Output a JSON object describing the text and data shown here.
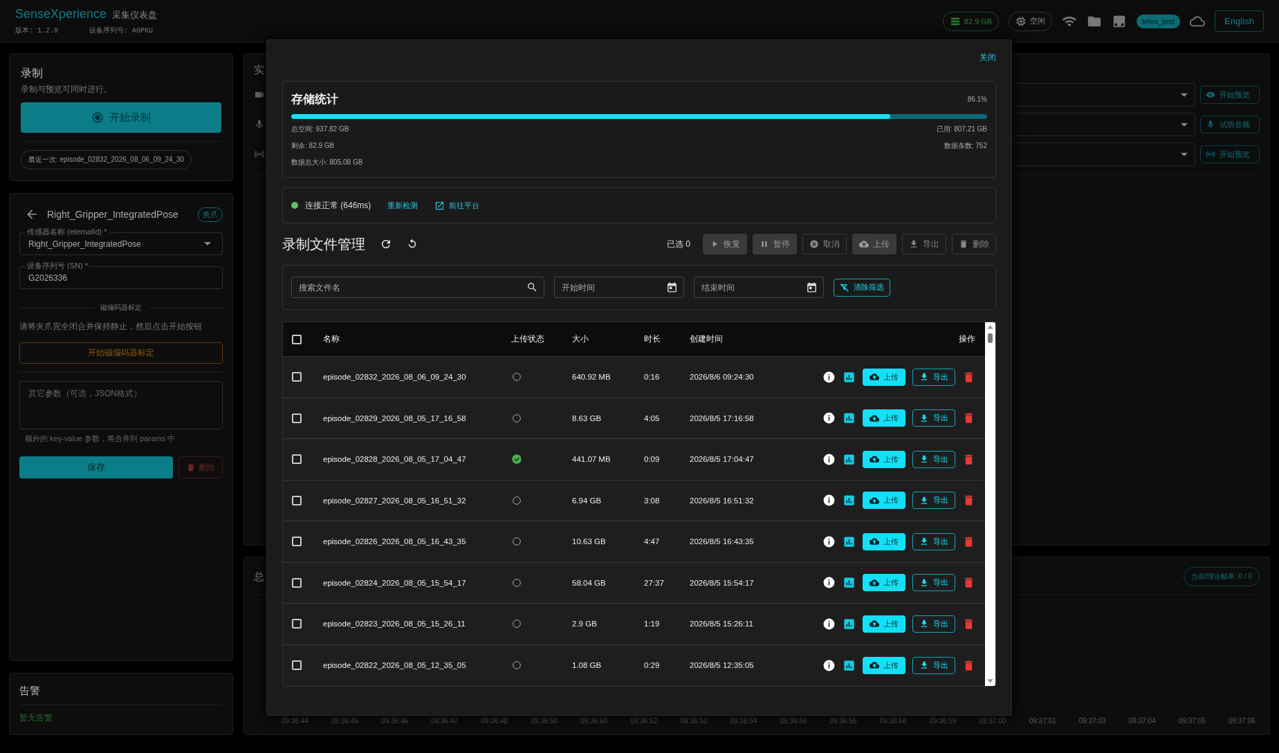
{
  "header": {
    "title": "SenseXperience",
    "subtitle": "采集仪表盘",
    "version": "版本: 1.2.0",
    "serial": "设备序列号: AGPKU",
    "storage": "82.9 GB",
    "status": "空闲",
    "user": "telex_test",
    "language": "English"
  },
  "recording": {
    "title": "录制",
    "hint": "录制与预览可同时进行。",
    "start": "开始录制",
    "last": "最近一次: episode_02832_2026_08_06_09_24_30"
  },
  "sensor": {
    "title": "Right_Gripper_IntegratedPose",
    "tag": "夹爪",
    "name_label": "传感器名称 (eternalId) *",
    "name_value": "Right_Gripper_IntegratedPose",
    "sn_label": "设备序列号 (SN) *",
    "sn_value": "G2026336",
    "section": "磁编码器标定",
    "instruction": "请将夹爪完全闭合并保持静止，然后点击开始按钮",
    "calibrate": "开始磁编码器标定",
    "params_placeholder": "其它参数（可选，JSON格式）",
    "params_help": "额外的 key-value 参数，将合并到 params 中",
    "save": "保存",
    "delete": "删除"
  },
  "alarms": {
    "title": "告警",
    "empty": "暂无告警"
  },
  "preview": {
    "title": "实",
    "buttons": [
      {
        "kind": "camera",
        "label": "开始预览"
      },
      {
        "kind": "mic",
        "label": "试听音频"
      },
      {
        "kind": "radio",
        "label": "开始预览"
      }
    ]
  },
  "stats_panel": {
    "title": "总",
    "badge": "当前/理论帧率: 0 / 0",
    "time_labels": [
      "09:36:44",
      "09:36:45",
      "09:36:46",
      "09:36:47",
      "09:36:48",
      "09:36:50",
      "09:36:50",
      "09:36:52",
      "09:36:53",
      "09:36:54",
      "09:36:56",
      "09:36:56",
      "09:36:58",
      "09:36:59",
      "09:37:00",
      "09:37:01",
      "09:37:03",
      "09:37:04",
      "09:37:05",
      "09:37:06"
    ]
  },
  "dialog": {
    "close": "关闭",
    "storage": {
      "title": "存储统计",
      "percent": "86.1%",
      "level": 0.861,
      "total": "总空间: 937.82 GB",
      "used": "已用: 807.21 GB",
      "free": "剩余: 82.9 GB",
      "count": "数据条数: 752",
      "data_size": "数据总大小: 805.08 GB"
    },
    "connection": {
      "ok": true,
      "text": "连接正常 (646ms)",
      "recheck": "重新检测",
      "platform": "前往平台"
    },
    "files": {
      "title": "录制文件管理",
      "selected": "已选 0",
      "all_checked": false,
      "actions": [
        {
          "kind": "resume",
          "label": "恢复",
          "disabled": true
        },
        {
          "kind": "pause",
          "label": "暂停",
          "disabled": true
        },
        {
          "kind": "cancel",
          "label": "取消",
          "disabled": true
        },
        {
          "kind": "upload",
          "label": "上传",
          "disabled": true
        },
        {
          "kind": "export",
          "label": "导出",
          "disabled": true
        },
        {
          "kind": "delete",
          "label": "删除",
          "disabled": true
        }
      ],
      "search_placeholder": "搜索文件名",
      "start_placeholder": "开始时间",
      "end_placeholder": "结束时间",
      "clear": "清除筛选",
      "columns": [
        "名称",
        "上传状态",
        "大小",
        "时长",
        "创建时间",
        "操作"
      ],
      "rows": [
        {
          "checked": false,
          "name": "episode_02832_2026_08_06_09_24_30",
          "uploaded": false,
          "size": "640.92 MB",
          "duration": "0:16",
          "created": "2026/8/6 09:24:30",
          "upload": "上传",
          "export": "导出"
        },
        {
          "checked": false,
          "name": "episode_02829_2026_08_05_17_16_58",
          "uploaded": false,
          "size": "8.63 GB",
          "duration": "4:05",
          "created": "2026/8/5 17:16:58",
          "upload": "上传",
          "export": "导出"
        },
        {
          "checked": false,
          "name": "episode_02828_2026_08_05_17_04_47",
          "uploaded": true,
          "size": "441.07 MB",
          "duration": "0:09",
          "created": "2026/8/5 17:04:47",
          "upload": "上传",
          "export": "导出"
        },
        {
          "checked": false,
          "name": "episode_02827_2026_08_05_16_51_32",
          "uploaded": false,
          "size": "6.94 GB",
          "duration": "3:08",
          "created": "2026/8/5 16:51:32",
          "upload": "上传",
          "export": "导出"
        },
        {
          "checked": false,
          "name": "episode_02826_2026_08_05_16_43_35",
          "uploaded": false,
          "size": "10.63 GB",
          "duration": "4:47",
          "created": "2026/8/5 16:43:35",
          "upload": "上传",
          "export": "导出"
        },
        {
          "checked": false,
          "name": "episode_02824_2026_08_05_15_54_17",
          "uploaded": false,
          "size": "58.04 GB",
          "duration": "27:37",
          "created": "2026/8/5 15:54:17",
          "upload": "上传",
          "export": "导出"
        },
        {
          "checked": false,
          "name": "episode_02823_2026_08_05_15_26_11",
          "uploaded": false,
          "size": "2.9 GB",
          "duration": "1:19",
          "created": "2026/8/5 15:26:11",
          "upload": "上传",
          "export": "导出"
        },
        {
          "checked": false,
          "name": "episode_02822_2026_08_05_12_35_05",
          "uploaded": false,
          "size": "1.08 GB",
          "duration": "0:29",
          "created": "2026/8/5 12:35:05",
          "upload": "上传",
          "export": "导出"
        }
      ]
    }
  }
}
